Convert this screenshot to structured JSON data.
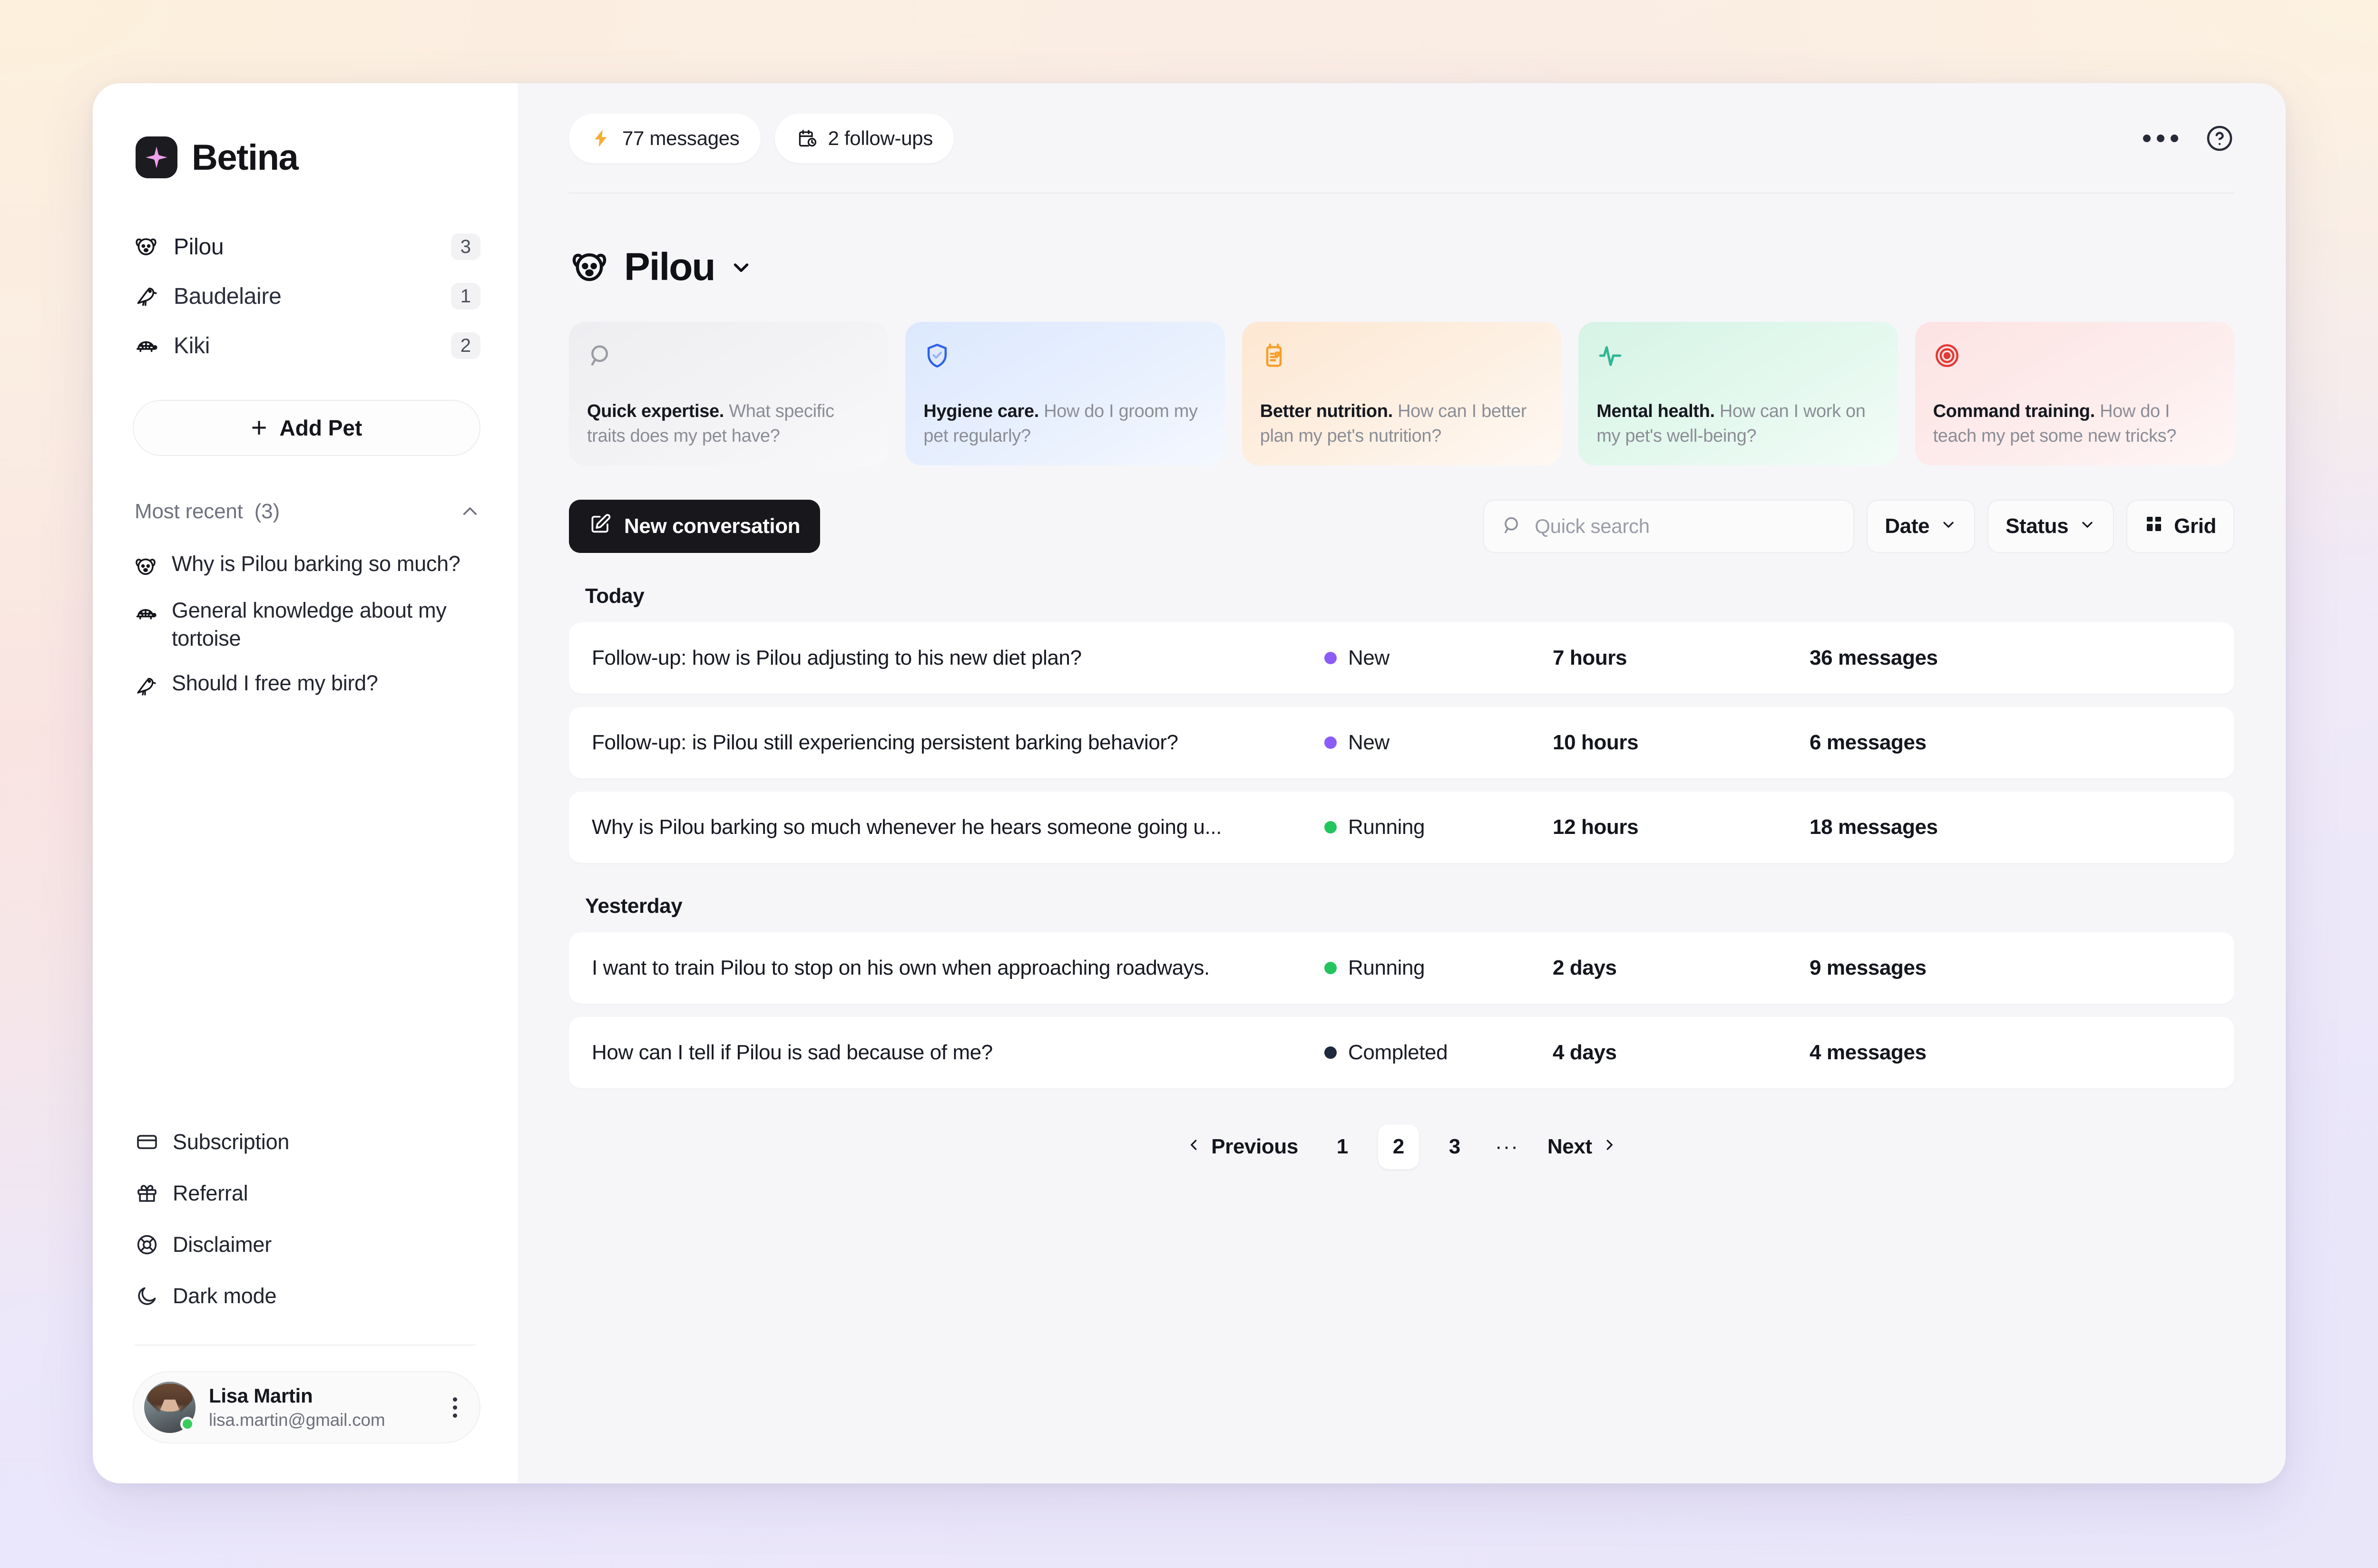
{
  "brand": {
    "name": "Betina",
    "mark_icon": "sparkle-icon"
  },
  "sidebar": {
    "pets": [
      {
        "name": "Pilou",
        "badge": "3",
        "icon": "dog-icon"
      },
      {
        "name": "Baudelaire",
        "badge": "1",
        "icon": "bird-icon"
      },
      {
        "name": "Kiki",
        "badge": "2",
        "icon": "tortoise-icon"
      }
    ],
    "add_pet_label": "Add Pet",
    "recent_section": {
      "label": "Most recent",
      "count": "(3)",
      "collapse_icon": "chevron-up-icon"
    },
    "recent_items": [
      {
        "title": "Why is Pilou barking so much?",
        "icon": "dog-icon"
      },
      {
        "title": "General knowledge about my tortoise",
        "icon": "tortoise-icon"
      },
      {
        "title": "Should I free my bird?",
        "icon": "bird-icon"
      }
    ],
    "nav": [
      {
        "label": "Subscription",
        "icon": "credit-card-icon"
      },
      {
        "label": "Referral",
        "icon": "gift-icon"
      },
      {
        "label": "Disclaimer",
        "icon": "lifebuoy-icon"
      },
      {
        "label": "Dark mode",
        "icon": "moon-icon"
      }
    ],
    "user": {
      "name": "Lisa Martin",
      "email": "lisa.martin@gmail.com",
      "status": "online",
      "menu_icon": "kebab-menu-icon"
    }
  },
  "topbar": {
    "chips": [
      {
        "label": "77 messages",
        "icon": "lightning-icon"
      },
      {
        "label": "2 follow-ups",
        "icon": "calendar-clock-icon"
      }
    ],
    "more_icon": "more-horizontal-icon",
    "help_icon": "help-circle-icon"
  },
  "page": {
    "title": "Pilou",
    "title_icon": "dog-icon",
    "title_chevron": "chevron-down-icon"
  },
  "cards": [
    {
      "title": "Quick expertise.",
      "body": "What specific traits does my pet have?",
      "icon": "search-icon",
      "theme": "c-grey",
      "accent": "#9a9ca4"
    },
    {
      "title": "Hygiene care.",
      "body": "How do I groom my pet regularly?",
      "icon": "shield-check-icon",
      "theme": "c-blue",
      "accent": "#2f62ea"
    },
    {
      "title": "Better nutrition.",
      "body": "How can I better plan my pet's nutrition?",
      "icon": "nutrition-calendar-icon",
      "theme": "c-orange",
      "accent": "#f5a02c"
    },
    {
      "title": "Mental health.",
      "body": "How can I work on my pet's well-being?",
      "icon": "pulse-icon",
      "theme": "c-green",
      "accent": "#2fb695"
    },
    {
      "title": "Command training.",
      "body": "How do I teach my pet some new tricks?",
      "icon": "target-icon",
      "theme": "c-red",
      "accent": "#e23b37"
    }
  ],
  "toolbar": {
    "new_conversation_label": "New conversation",
    "new_conversation_icon": "compose-icon",
    "search_placeholder": "Quick search",
    "search_value": "",
    "search_icon": "search-icon",
    "date_filter_label": "Date",
    "status_filter_label": "Status",
    "grid_label": "Grid",
    "grid_icon": "grid-icon",
    "chevron_icon": "chevron-down-icon"
  },
  "groups": [
    {
      "label": "Today",
      "rows": [
        {
          "title": "Follow-up: how is Pilou adjusting to his new diet plan?",
          "status": "New",
          "status_color": "#8b5cf6",
          "time": "7 hours",
          "messages": "36 messages"
        },
        {
          "title": "Follow-up: is Pilou still experiencing persistent barking behavior?",
          "status": "New",
          "status_color": "#8b5cf6",
          "time": "10 hours",
          "messages": "6 messages"
        },
        {
          "title": "Why is Pilou barking so much whenever he hears someone going u...",
          "status": "Running",
          "status_color": "#22c55e",
          "time": "12 hours",
          "messages": "18 messages"
        }
      ]
    },
    {
      "label": "Yesterday",
      "rows": [
        {
          "title": "I want to train Pilou to stop on his own when approaching roadways.",
          "status": "Running",
          "status_color": "#22c55e",
          "time": "2 days",
          "messages": "9 messages"
        },
        {
          "title": "How can I tell if Pilou is sad because of me?",
          "status": "Completed",
          "status_color": "#1e293b",
          "time": "4 days",
          "messages": "4 messages"
        }
      ]
    }
  ],
  "pagination": {
    "previous_label": "Previous",
    "next_label": "Next",
    "pages": [
      "1",
      "2",
      "3"
    ],
    "current": "2",
    "ellipsis": "···",
    "prev_icon": "chevron-left-icon",
    "next_icon": "chevron-right-icon"
  },
  "theme": {
    "accent_dark": "#18181c",
    "brand_sparkle": "#f0a0ec",
    "panel_bg": "#f6f6f9"
  }
}
